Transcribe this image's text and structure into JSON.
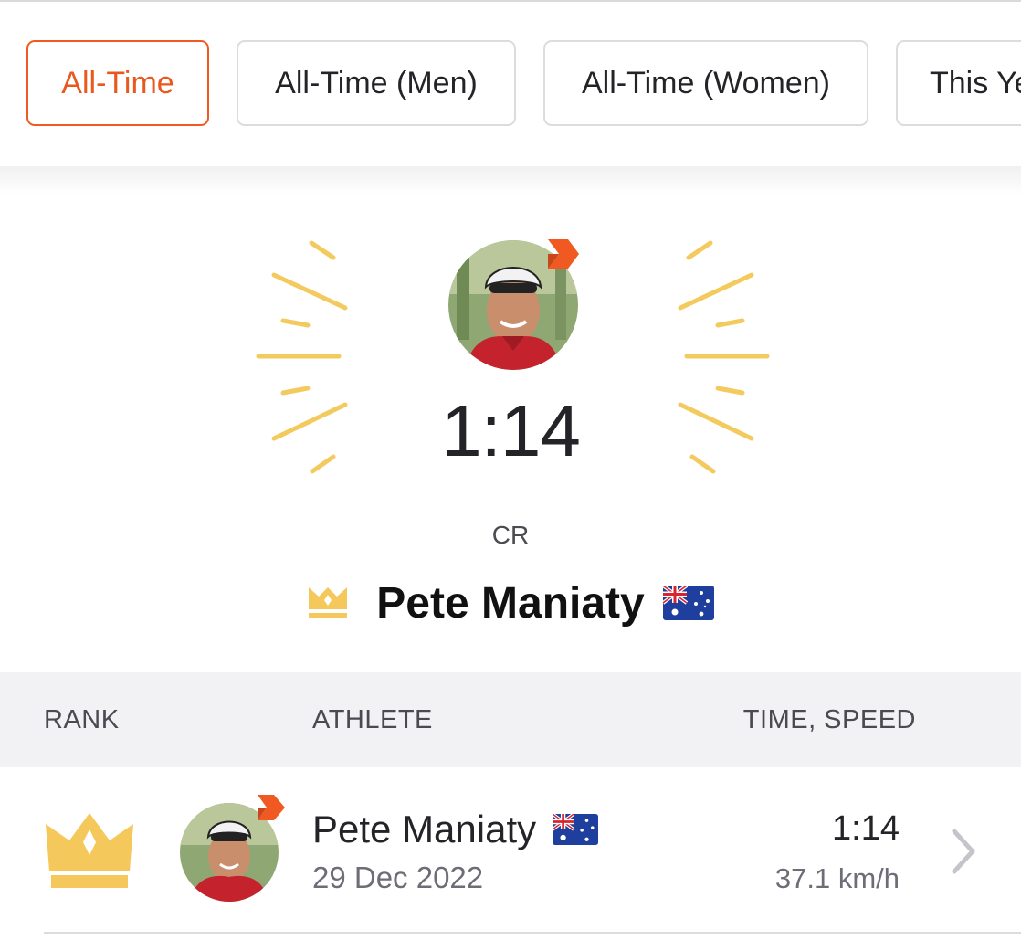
{
  "filters": {
    "tabs": [
      {
        "label": "All-Time"
      },
      {
        "label": "All-Time (Men)"
      },
      {
        "label": "All-Time (Women)"
      },
      {
        "label": "This Ye"
      }
    ],
    "active_index": 0
  },
  "leader": {
    "time": "1:14",
    "achievement": "CR",
    "name": "Pete Maniaty",
    "flag": "australia-flag-icon",
    "crown": "crown-icon"
  },
  "table": {
    "headers": {
      "rank": "RANK",
      "athlete": "ATHLETE",
      "time_speed": "TIME, SPEED"
    },
    "rows": [
      {
        "rank_icon": "crown-icon",
        "name": "Pete Maniaty",
        "date": "29 Dec 2022",
        "time": "1:14",
        "speed": "37.1 km/h"
      }
    ]
  },
  "colors": {
    "accent": "#f05a22",
    "gold": "#f5c85c",
    "ray": "#f3ca5e",
    "text": "#242428",
    "muted": "#6d6d78",
    "header_bg": "#f2f2f4"
  }
}
